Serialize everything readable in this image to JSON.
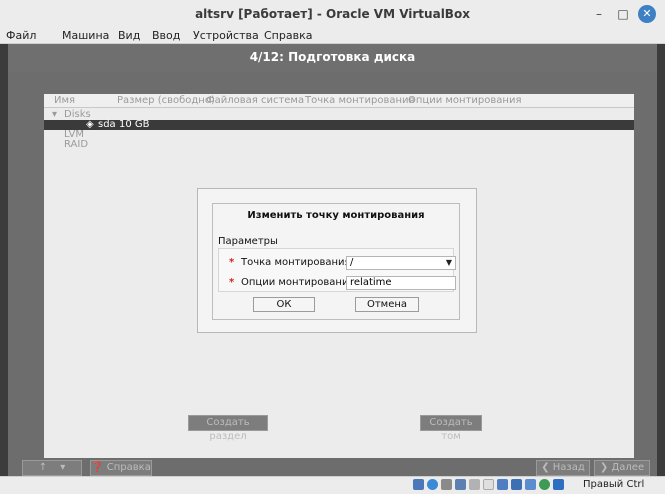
{
  "window": {
    "title": "altsrv [Работает] - Oracle VM VirtualBox",
    "minimize_glyph": "–",
    "maximize_glyph": "□",
    "close_glyph": "✕"
  },
  "menu": [
    "Файл",
    "Машина",
    "Вид",
    "Ввод",
    "Устройства",
    "Справка"
  ],
  "installer": {
    "step_title": "4/12: Подготовка диска",
    "columns": [
      "Имя",
      "Размер (свободно)",
      "Файловая система",
      "Точка монтирования",
      "Опции монтирования"
    ],
    "tree": {
      "disks_label": "Disks",
      "sda_label": "sda",
      "sda_size": "10 GB",
      "lvm_label": "LVM",
      "raid_label": "RAID"
    },
    "create_partition_label": "Создать раздел",
    "create_volume_label": "Создать том",
    "footer": {
      "up_label": "",
      "help_label": "Справка",
      "back_label": "Назад",
      "next_label": "Далее"
    }
  },
  "dialog": {
    "title": "Изменить точку монтирования",
    "section_label": "Параметры",
    "required_mark": "*",
    "mount_point_label": "Точка монтирования",
    "mount_point_value": "/",
    "mount_options_label": "Опции монтирования",
    "mount_options_value": "relatime",
    "ok_label": "ОК",
    "cancel_label": "Отмена"
  },
  "statusbar": {
    "host_key": "Правый Ctrl",
    "icons": [
      "hard-disk-icon",
      "optical-drive-icon",
      "audio-icon",
      "network-icon",
      "usb-icon",
      "shared-folders-icon",
      "display-icon",
      "video-capture-icon",
      "cpu-icon",
      "mouse-integration-icon",
      "keyboard-icon"
    ]
  }
}
